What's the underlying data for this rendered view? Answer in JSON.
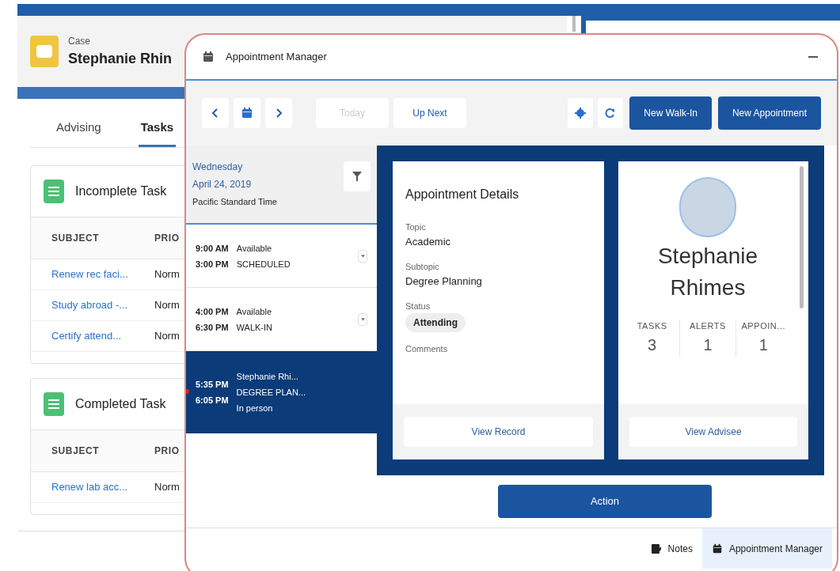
{
  "background": {
    "record_type": "Case",
    "record_name": "Stephanie Rhin",
    "tabs": [
      {
        "label": "Advising",
        "selected": false
      },
      {
        "label": "Tasks",
        "selected": true
      }
    ],
    "task_cards": [
      {
        "title": "Incomplete Task",
        "columns": [
          "SUBJECT",
          "PRIO"
        ],
        "rows": [
          [
            "Renew rec faci...",
            "Norm"
          ],
          [
            "Study abroad -...",
            "Norm"
          ],
          [
            "Certify attend...",
            "Norm"
          ]
        ]
      },
      {
        "title": "Completed Task",
        "columns": [
          "SUBJECT",
          "PRIO"
        ],
        "rows": [
          [
            "Renew lab acc...",
            "Norm"
          ]
        ]
      }
    ]
  },
  "appointment_manager": {
    "title": "Appointment Manager",
    "toolbar": {
      "today": {
        "label": "Today",
        "disabled": true
      },
      "up_next": "Up Next",
      "buttons": [
        "New Walk-In",
        "New Appointment"
      ]
    },
    "date": {
      "weekday": "Wednesday",
      "date": "April 24, 2019",
      "timezone": "Pacific Standard Time"
    },
    "slots": [
      {
        "start": "9:00 AM",
        "end": "3:00 PM",
        "lines": [
          "Available",
          "SCHEDULED"
        ],
        "selected": false,
        "menu": true,
        "current_time": false
      },
      {
        "start": "4:00 PM",
        "end": "6:30 PM",
        "lines": [
          "Available",
          "WALK-IN"
        ],
        "selected": false,
        "menu": true,
        "current_time": false
      },
      {
        "start": "5:35 PM",
        "end": "6:05 PM",
        "lines": [
          "Stephanie Rhi...",
          "DEGREE PLAN...",
          "In person"
        ],
        "selected": true,
        "menu": false,
        "current_time": true
      }
    ],
    "details": {
      "title": "Appointment Details",
      "fields": [
        {
          "label": "Topic",
          "value": "Academic",
          "kind": "text"
        },
        {
          "label": "Subtopic",
          "value": "Degree Planning",
          "kind": "text"
        },
        {
          "label": "Status",
          "value": "Attending",
          "kind": "pill"
        },
        {
          "label": "Comments"
        }
      ],
      "button": "View Record"
    },
    "advisee": {
      "first_name": "Stephanie",
      "last_name": "Rhimes",
      "stats": [
        {
          "label": "TASKS",
          "value": "3"
        },
        {
          "label": "ALERTS",
          "value": "1"
        },
        {
          "label": "APPOIN...",
          "value": "1"
        }
      ],
      "button": "View Advisee"
    },
    "action": "Action"
  },
  "utility_bar": [
    {
      "label": "Notes",
      "kind": "notes",
      "selected": false
    },
    {
      "label": "Appointment Manager",
      "kind": "calendar",
      "selected": true
    }
  ]
}
